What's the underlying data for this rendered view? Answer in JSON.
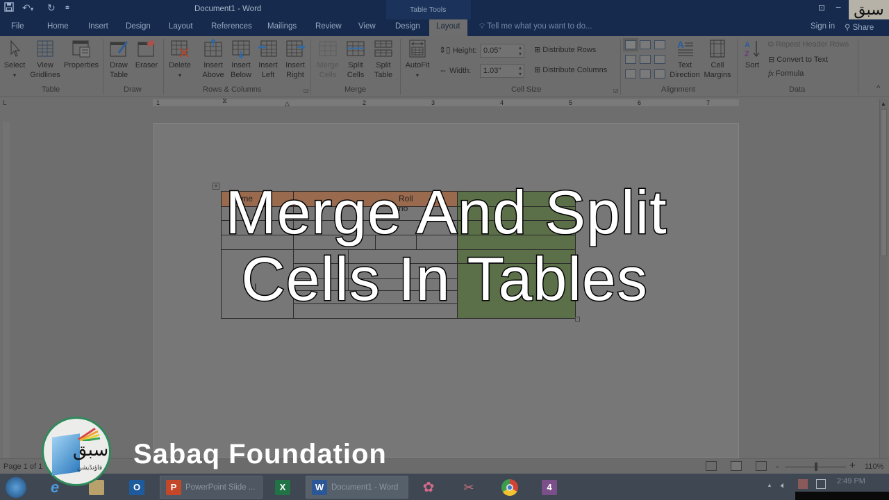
{
  "titlebar": {
    "title": "Document1 - Word",
    "contextual_group": "Table Tools",
    "qat": {
      "save_icon": "save-icon",
      "undo_icon": "undo-icon",
      "redo_icon": "redo-icon",
      "customize_icon": "customize-qat-icon"
    },
    "restore_glyph": "⊡",
    "minimize_glyph": "−",
    "watermark_badge": "سبق"
  },
  "tabs": [
    {
      "label": "File"
    },
    {
      "label": "Home"
    },
    {
      "label": "Insert"
    },
    {
      "label": "Design"
    },
    {
      "label": "Layout"
    },
    {
      "label": "References"
    },
    {
      "label": "Mailings"
    },
    {
      "label": "Review"
    },
    {
      "label": "View"
    },
    {
      "label": "Design"
    },
    {
      "label": "Layout",
      "active": true
    }
  ],
  "tell_me": "Tell me what you want to do...",
  "sign_in": "Sign in",
  "share": "Share",
  "ribbon": {
    "groups": {
      "table": "Table",
      "draw": "Draw",
      "rows_columns": "Rows & Columns",
      "merge": "Merge",
      "cell_size": "Cell Size",
      "alignment": "Alignment",
      "data": "Data"
    },
    "buttons": {
      "select": "Select",
      "view_gridlines_1": "View",
      "view_gridlines_2": "Gridlines",
      "properties": "Properties",
      "draw_table_1": "Draw",
      "draw_table_2": "Table",
      "eraser": "Eraser",
      "delete": "Delete",
      "insert_above_1": "Insert",
      "insert_above_2": "Above",
      "insert_below_1": "Insert",
      "insert_below_2": "Below",
      "insert_left_1": "Insert",
      "insert_left_2": "Left",
      "insert_right_1": "Insert",
      "insert_right_2": "Right",
      "merge_cells_1": "Merge",
      "merge_cells_2": "Cells",
      "split_cells_1": "Split",
      "split_cells_2": "Cells",
      "split_table_1": "Split",
      "split_table_2": "Table",
      "autofit": "AutoFit",
      "text_direction_1": "Text",
      "text_direction_2": "Direction",
      "cell_margins_1": "Cell",
      "cell_margins_2": "Margins",
      "sort": "Sort"
    },
    "cell_size": {
      "height_label": "Height:",
      "height_value": "0.05\"",
      "width_label": "Width:",
      "width_value": "1.03\"",
      "distribute_rows": "Distribute Rows",
      "distribute_columns": "Distribute Columns"
    },
    "data_cmds": {
      "repeat_header_rows": "Repeat Header Rows",
      "convert_to_text": "Convert to Text",
      "formula": "Formula",
      "formula_glyph": "fx"
    },
    "collapse_glyph": "^"
  },
  "ruler": {
    "corner_glyph": "L",
    "numbers": [
      "1",
      "2",
      "3",
      "4",
      "5",
      "6",
      "7"
    ]
  },
  "document": {
    "table": {
      "header_cells": [
        "Name",
        "Roll no"
      ],
      "header_color": "#9a6a4e",
      "highlight_color": "#5b7048"
    }
  },
  "overlay": {
    "line1": "Merge And Split",
    "line2": "Cells In Tables"
  },
  "statusbar": {
    "page_count": "Page 1 of 1",
    "zoom_level": "110%",
    "zoom_percent": 110,
    "zoom_minus": "-",
    "zoom_plus": "+"
  },
  "taskbar": {
    "windows": [
      {
        "label": "PowerPoint Slide ...",
        "app": "P",
        "color": "#c4472a"
      },
      {
        "label": "Document1 - Word",
        "app": "W",
        "color": "#2b5797"
      }
    ],
    "excel_app": "X",
    "outlook_app": "O",
    "clock": "2:49 PM"
  },
  "branding": {
    "logo_text": "سبق",
    "logo_subtext": "فاؤنڈیشن",
    "name": "Sabaq Foundation"
  }
}
